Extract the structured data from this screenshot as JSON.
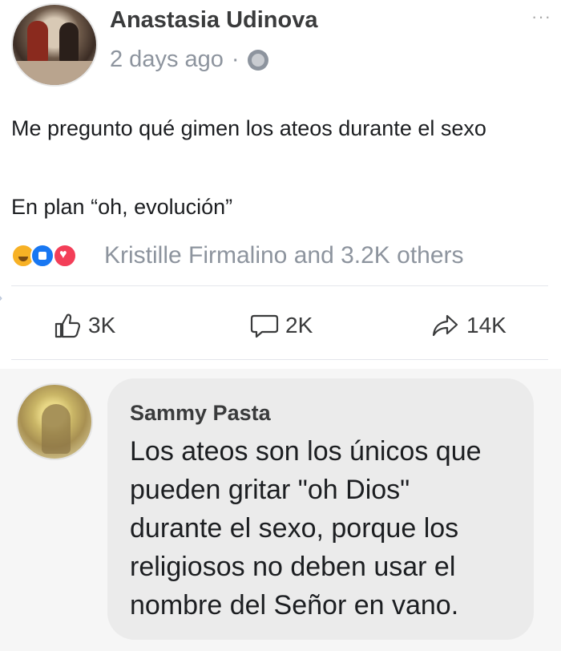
{
  "post": {
    "author": "Anastasia Udinova",
    "time": "2 days ago",
    "separator": "·",
    "text_line_1": "Me pregunto qué gimen los ateos durante el sexo",
    "text_line_2": "En plan “oh, evolución”",
    "more_label": "···"
  },
  "reactions": {
    "icons": [
      "haha-reaction-icon",
      "like-reaction-icon",
      "love-reaction-icon"
    ],
    "summary": "Kristille Firmalino and 3.2K others"
  },
  "actions": {
    "like_count": "3K",
    "comment_count": "2K",
    "share_count": "14K"
  },
  "comment": {
    "author": "Sammy Pasta",
    "lines": [
      "Los ateos son los únicos que",
      "pueden gritar \"oh Dios\"",
      "durante el sexo, porque los",
      "religiosos no deben usar el",
      "nombre del Señor en vano."
    ]
  },
  "colors": {
    "secondary_text": "#8d949e",
    "comment_bubble": "#ebebeb",
    "like_blue": "#1877f2",
    "love_red": "#f33e58",
    "haha_yellow": "#f7b125"
  }
}
